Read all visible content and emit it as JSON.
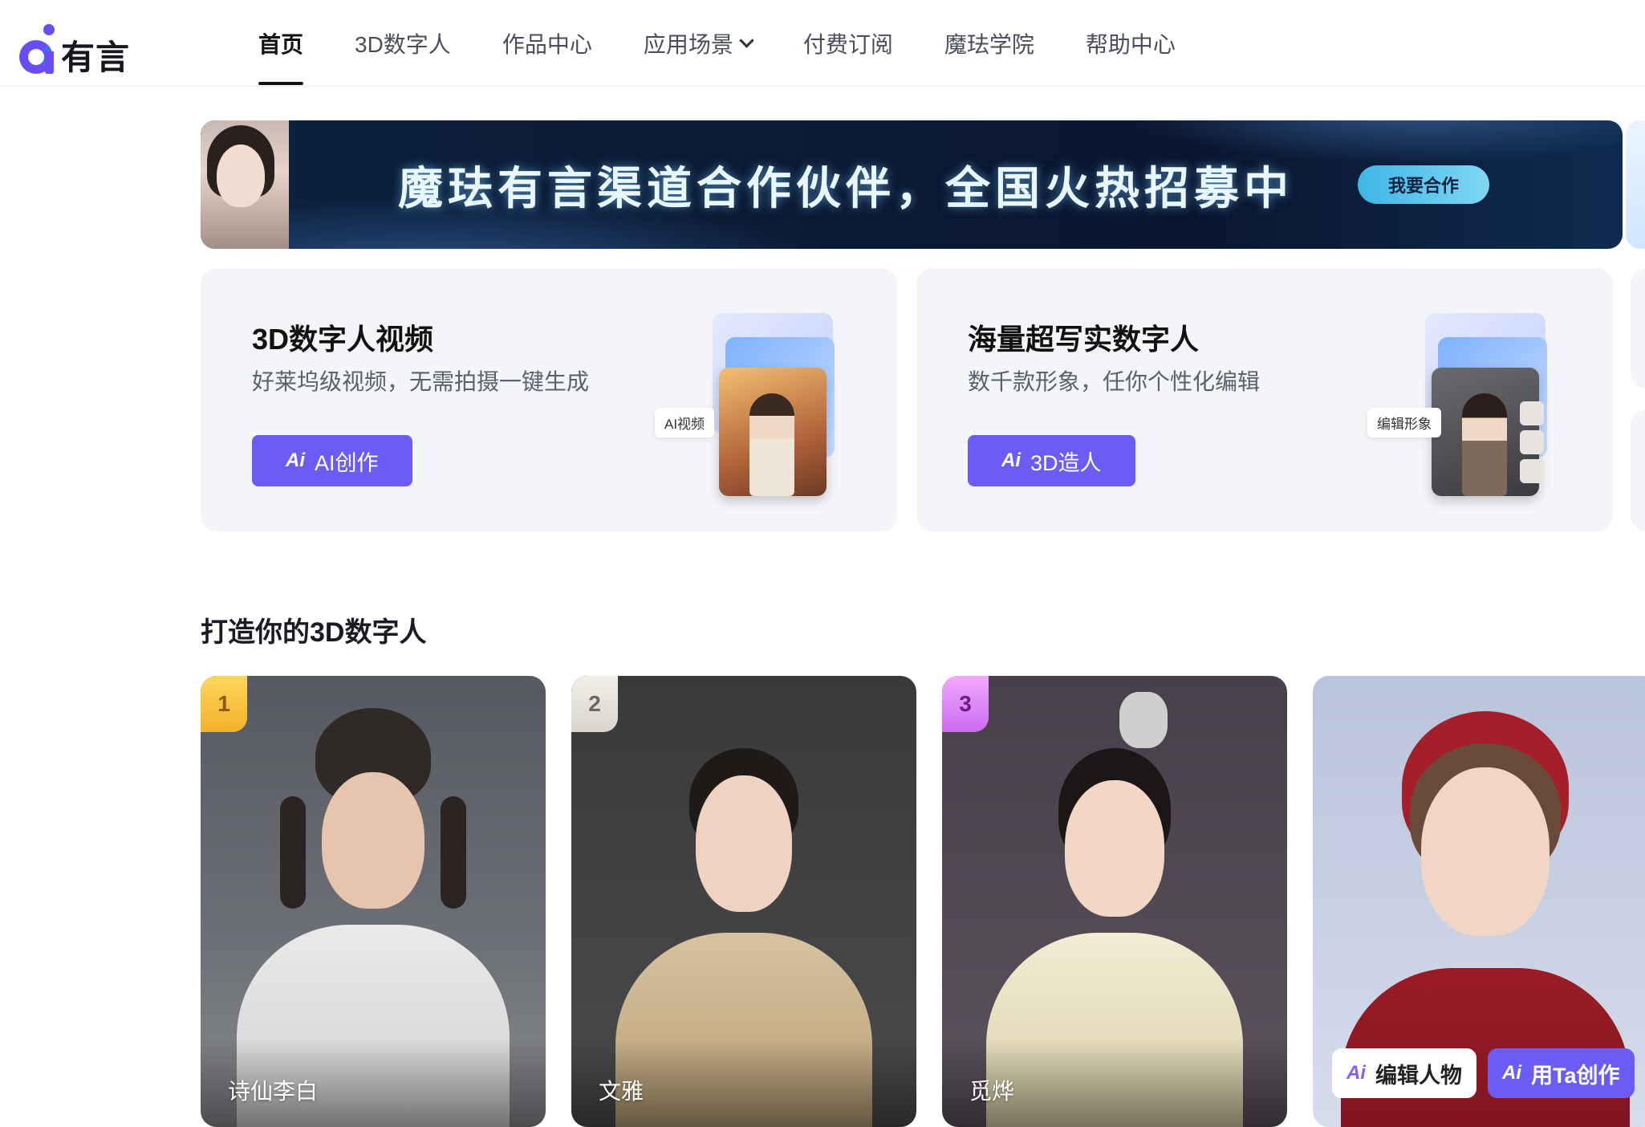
{
  "logo": {
    "text": "有言"
  },
  "nav": {
    "items": [
      {
        "label": "首页",
        "active": true
      },
      {
        "label": "3D数字人"
      },
      {
        "label": "作品中心"
      },
      {
        "label": "应用场景",
        "dropdown": true
      },
      {
        "label": "付费订阅"
      },
      {
        "label": "魔珐学院"
      },
      {
        "label": "帮助中心"
      }
    ]
  },
  "banner": {
    "title": "魔珐有言渠道合作伙伴，全国火热招募中",
    "button": "我要合作"
  },
  "features": [
    {
      "title": "3D数字人视频",
      "subtitle": "好莱坞级视频，无需拍摄一键生成",
      "ai_badge": "Ai",
      "button": "AI创作",
      "illus_tag": "AI视频"
    },
    {
      "title": "海量超写实数字人",
      "subtitle": "数千款形象，任你个性化编辑",
      "ai_badge": "Ai",
      "button": "3D造人",
      "illus_tag": "编辑形象"
    }
  ],
  "section": {
    "title": "打造你的3D数字人"
  },
  "avatars": [
    {
      "rank": "1",
      "name": "诗仙李白"
    },
    {
      "rank": "2",
      "name": "文雅"
    },
    {
      "rank": "3",
      "name": "觅烨"
    },
    {
      "rank": "",
      "name": ""
    }
  ],
  "card_actions": {
    "ai_badge": "Ai",
    "edit": "编辑人物",
    "create": "用Ta创作"
  },
  "colors": {
    "accent": "#6b5cf6",
    "logo": "#6a4cf5",
    "banner_bg": "#0b1b36",
    "card_bg": "#f4f5f8"
  }
}
